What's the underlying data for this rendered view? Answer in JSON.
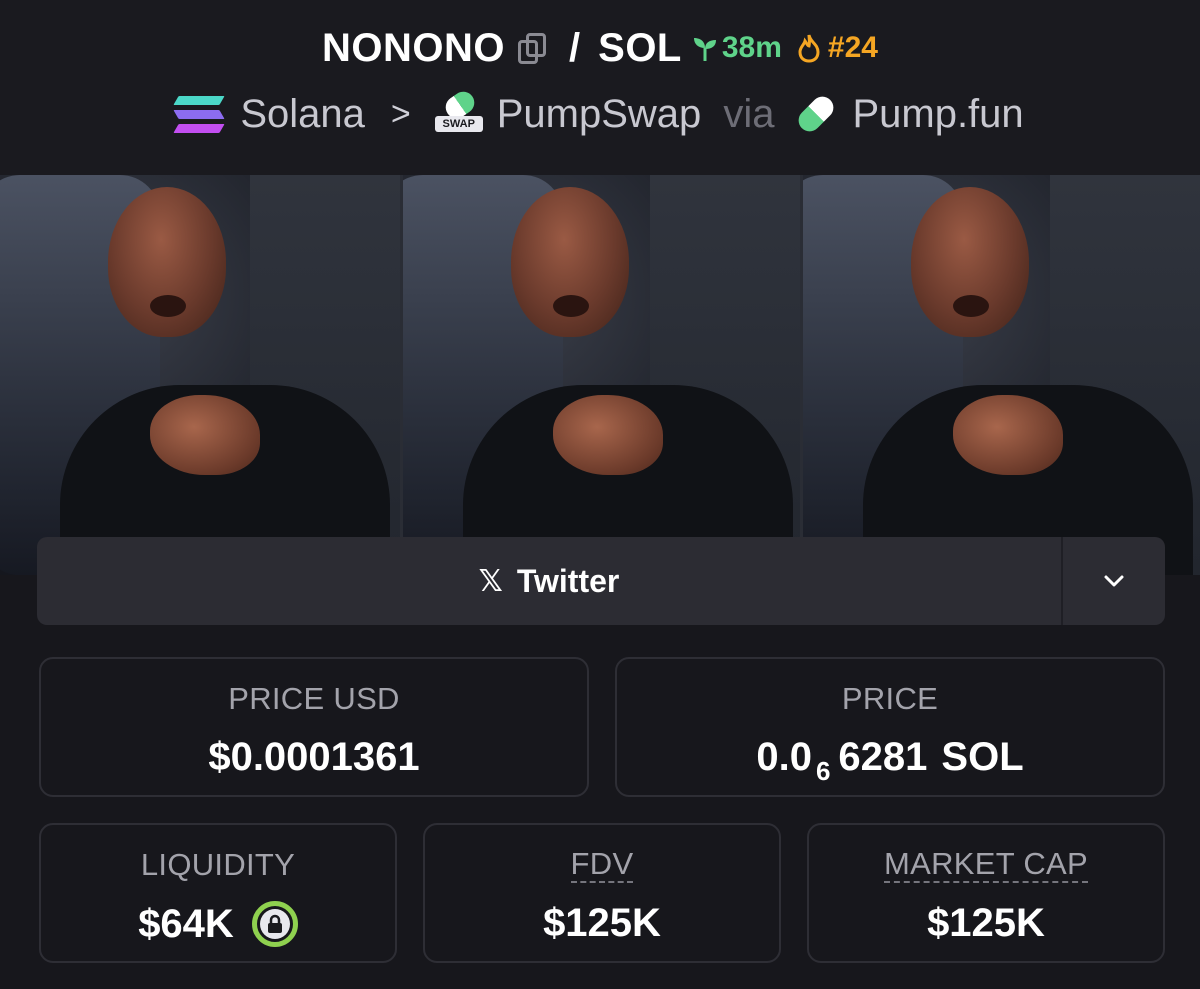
{
  "header": {
    "token": "NONONO",
    "separator": "/",
    "quote": "SOL",
    "age": "38m",
    "rank": "#24",
    "colors": {
      "age": "#5fd38a",
      "rank": "#f5a623"
    },
    "icons": [
      "copy-icon",
      "sprout-icon",
      "flame-icon"
    ]
  },
  "path": {
    "chain": "Solana",
    "chevron": ">",
    "dex": "PumpSwap",
    "dex_tag": "SWAP",
    "via": "via",
    "launchpad": "Pump.fun"
  },
  "social": {
    "twitter_icon": "𝕏",
    "twitter_label": "Twitter"
  },
  "stats": {
    "price_usd": {
      "label": "PRICE USD",
      "value": "$0.0001361"
    },
    "price": {
      "label": "PRICE",
      "prefix": "0.0",
      "zero_count": "6",
      "digits": "6281",
      "unit": "SOL"
    },
    "liquidity": {
      "label": "LIQUIDITY",
      "value": "$64K",
      "locked": true
    },
    "fdv": {
      "label": "FDV",
      "value": "$125K"
    },
    "market_cap": {
      "label": "MARKET CAP",
      "value": "$125K"
    }
  }
}
